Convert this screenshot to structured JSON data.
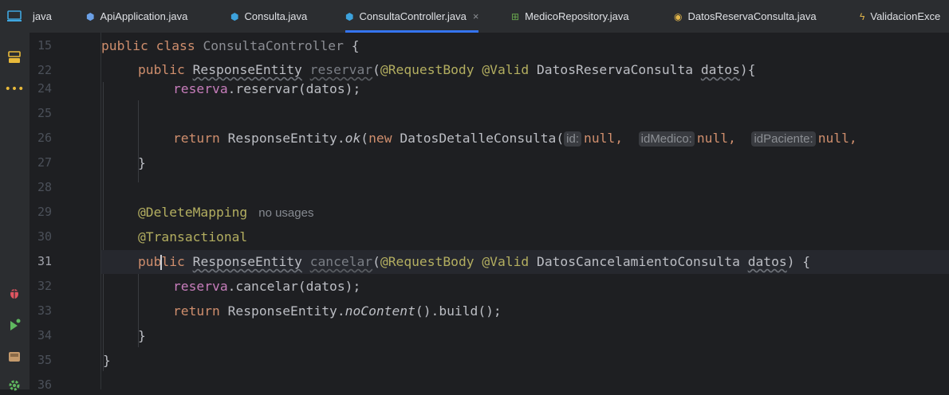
{
  "tabs": [
    {
      "label": "java",
      "icon": "java-file-icon",
      "color": "#6ba0e6"
    },
    {
      "label": "ApiApplication.java",
      "icon": "spring-app-icon",
      "color": "#6ba0e6"
    },
    {
      "label": "Consulta.java",
      "icon": "class-icon",
      "color": "#3da2dc"
    },
    {
      "label": "ConsultaController.java",
      "icon": "class-icon",
      "color": "#3da2dc",
      "active": true,
      "close": "×"
    },
    {
      "label": "MedicoRepository.java",
      "icon": "repository-icon",
      "color": "#6aa84f"
    },
    {
      "label": "DatosReservaConsulta.java",
      "icon": "record-icon",
      "color": "#e0b44a"
    },
    {
      "label": "ValidacionExce",
      "icon": "exception-icon",
      "color": "#e0b44a"
    }
  ],
  "line_numbers": [
    "15",
    "22",
    "24",
    "25",
    "26",
    "27",
    "28",
    "29",
    "30",
    "31",
    "32",
    "33",
    "34",
    "35",
    "36"
  ],
  "current_line": "31",
  "code": {
    "l15": {
      "kw": "public class ",
      "name": "ConsultaController",
      "rest": " {"
    },
    "l22": {
      "kw": "public ",
      "type": "ResponseEntity",
      "method": "reservar",
      "open": "(",
      "ann1": "@RequestBody",
      "ann2": "@Valid",
      "ptype": "DatosReservaConsulta",
      "param": "datos",
      "close": "){"
    },
    "l24": {
      "field": "reserva",
      "rest": ".reservar(datos);"
    },
    "l26": {
      "kw": "return ",
      "cls": "ResponseEntity.",
      "call": "ok",
      "open": "(",
      "kw2": "new ",
      "ctor": "DatosDetalleConsulta(",
      "h1": "id:",
      "v1": "null,",
      "h2": "idMedico:",
      "v2": "null,",
      "h3": "idPaciente:",
      "v3": "null,"
    },
    "l27": "}",
    "l29": {
      "ann": "@DeleteMapping",
      "usages": "no usages"
    },
    "l30": {
      "ann": "@Transactional"
    },
    "l31": {
      "kw_a": "pub",
      "kw_b": "lic ",
      "type": "ResponseEntity",
      "method": "cancelar",
      "open": "(",
      "ann1": "@RequestBody",
      "ann2": "@Valid",
      "ptype": "DatosCancelamientoConsulta",
      "param": "datos",
      "close": ") {"
    },
    "l32": {
      "field": "reserva",
      "rest": ".cancelar(datos);"
    },
    "l33": {
      "kw": "return ",
      "cls": "ResponseEntity.",
      "call": "noContent",
      "rest": "().build();"
    },
    "l34": "}",
    "l35": "}"
  }
}
